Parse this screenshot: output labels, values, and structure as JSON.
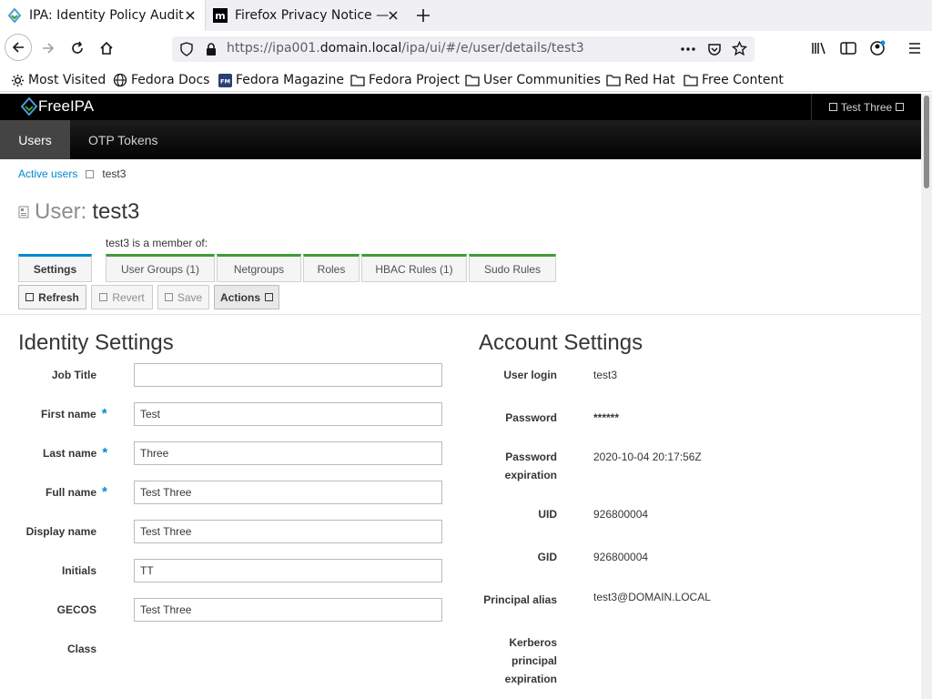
{
  "browser": {
    "tabs": [
      {
        "title": "IPA: Identity Policy Audit",
        "active": true
      },
      {
        "title": "Firefox Privacy Notice —",
        "active": false
      }
    ],
    "url_prefix": "https://ipa001.",
    "url_domain": "domain.local",
    "url_suffix": "/ipa/ui/#/e/user/details/test3",
    "bookmarks": [
      "Most Visited",
      "Fedora Docs",
      "Fedora Magazine",
      "Fedora Project",
      "User Communities",
      "Red Hat",
      "Free Content"
    ]
  },
  "app": {
    "logo_text": "FreeIPA",
    "current_user": "Test Three",
    "nav": [
      "Users",
      "OTP Tokens"
    ],
    "accent": "#0088ce",
    "member_tab_color": "#3f9c35"
  },
  "breadcrumb": {
    "parent": "Active users",
    "current": "test3"
  },
  "title": {
    "kind": "User:",
    "name": "test3"
  },
  "member_of": "test3 is a member of:",
  "tabs": [
    "Settings",
    "User Groups (1)",
    "Netgroups",
    "Roles",
    "HBAC Rules (1)",
    "Sudo Rules"
  ],
  "actions": {
    "refresh": "Refresh",
    "revert": "Revert",
    "save": "Save",
    "actions": "Actions"
  },
  "identity": {
    "title": "Identity Settings",
    "fields": [
      {
        "label": "Job Title",
        "value": "",
        "required": false
      },
      {
        "label": "First name",
        "value": "Test",
        "required": true
      },
      {
        "label": "Last name",
        "value": "Three",
        "required": true
      },
      {
        "label": "Full name",
        "value": "Test Three",
        "required": true
      },
      {
        "label": "Display name",
        "value": "Test Three",
        "required": false
      },
      {
        "label": "Initials",
        "value": "TT",
        "required": false
      },
      {
        "label": "GECOS",
        "value": "Test Three",
        "required": false
      },
      {
        "label": "Class",
        "value": "",
        "required": false
      }
    ],
    "required_mark": "*"
  },
  "account": {
    "title": "Account Settings",
    "fields": [
      {
        "label": "User login",
        "value": "test3"
      },
      {
        "label": "Password",
        "value": "******"
      },
      {
        "label_line1": "Password",
        "label_line2": "expiration",
        "value": "2020-10-04 20:17:56Z"
      },
      {
        "label": "UID",
        "value": "926800004"
      },
      {
        "label": "GID",
        "value": "926800004"
      },
      {
        "label": "Principal alias",
        "value": "test3@DOMAIN.LOCAL"
      },
      {
        "label_line1": "Kerberos",
        "label_line2": "principal",
        "label_line3": "expiration",
        "value": ""
      }
    ]
  }
}
